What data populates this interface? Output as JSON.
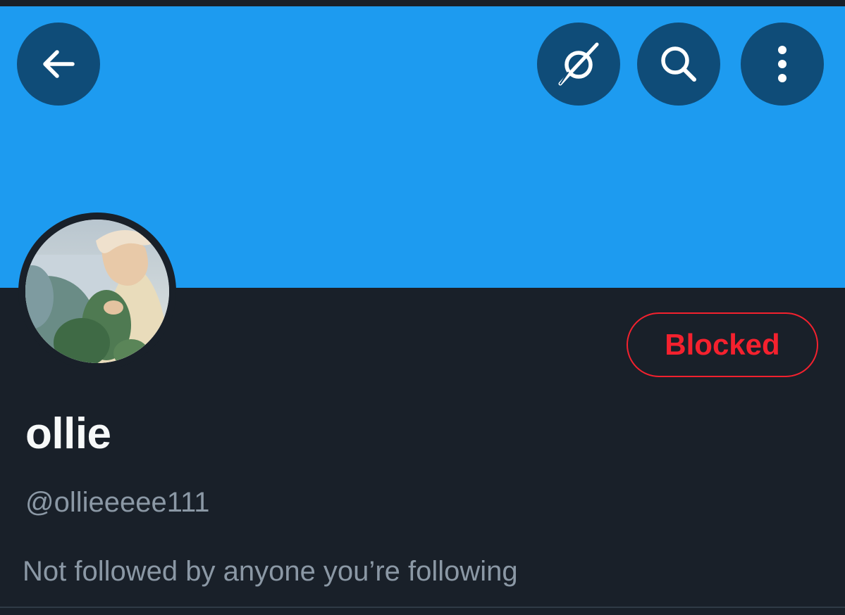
{
  "header": {
    "back_icon": "arrow-left-icon",
    "grok_icon": "grok-icon",
    "search_icon": "search-icon",
    "more_icon": "more-vertical-icon",
    "banner_color": "#1d9bf0",
    "button_color": "#0f4c78"
  },
  "profile": {
    "avatar_icon": "avatar-photo",
    "display_name": "ollie",
    "handle": "@ollieeeee111",
    "follow_note": "Not followed by anyone you’re following",
    "blocked_label": "Blocked",
    "blocked_color": "#f4212e"
  }
}
